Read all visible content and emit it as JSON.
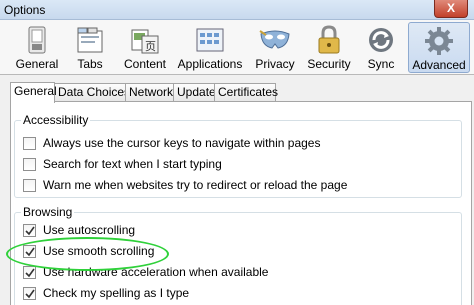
{
  "window": {
    "title": "Options",
    "close_label": "X"
  },
  "toolbar": {
    "panes": [
      {
        "label": "General",
        "icon": "general-switch-icon"
      },
      {
        "label": "Tabs",
        "icon": "tabs-icon"
      },
      {
        "label": "Content",
        "icon": "content-icon"
      },
      {
        "label": "Applications",
        "icon": "applications-icon"
      },
      {
        "label": "Privacy",
        "icon": "privacy-mask-icon"
      },
      {
        "label": "Security",
        "icon": "security-lock-icon"
      },
      {
        "label": "Sync",
        "icon": "sync-icon"
      },
      {
        "label": "Advanced",
        "icon": "advanced-gear-icon"
      }
    ],
    "selected": "Advanced"
  },
  "tabs": [
    "General",
    "Data Choices",
    "Network",
    "Update",
    "Certificates"
  ],
  "selected_tab": "General",
  "accessibility": {
    "title": "Accessibility",
    "options": [
      {
        "label": "Always use the cursor keys to navigate within pages",
        "checked": false
      },
      {
        "label": "Search for text when I start typing",
        "checked": false
      },
      {
        "label": "Warn me when websites try to redirect or reload the page",
        "checked": false
      }
    ]
  },
  "browsing": {
    "title": "Browsing",
    "options": [
      {
        "label": "Use autoscrolling",
        "checked": true
      },
      {
        "label": "Use smooth scrolling",
        "checked": true
      },
      {
        "label": "Use hardware acceleration when available",
        "checked": true
      },
      {
        "label": "Check my spelling as I type",
        "checked": true
      }
    ]
  },
  "colors": {
    "highlight_circle": "#2fd13a",
    "selected_pane": "#c9daf0"
  }
}
